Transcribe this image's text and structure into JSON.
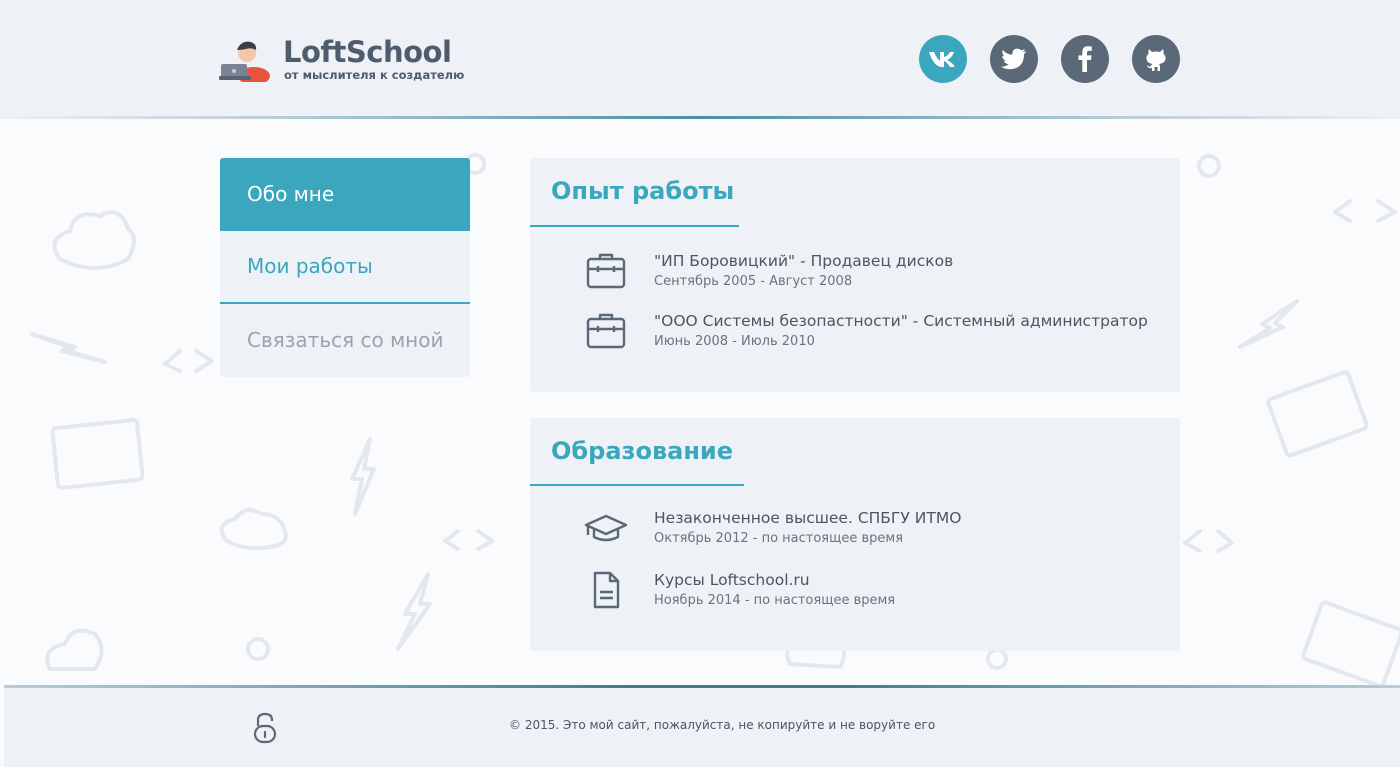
{
  "header": {
    "logo_title": "LoftSchool",
    "logo_subtitle": "от мыслителя к создателю",
    "socials": [
      {
        "name": "vk",
        "icon": "vk-icon",
        "active": true
      },
      {
        "name": "twitter",
        "icon": "twitter-icon",
        "active": false
      },
      {
        "name": "facebook",
        "icon": "facebook-icon",
        "active": false
      },
      {
        "name": "github",
        "icon": "github-icon",
        "active": false
      }
    ]
  },
  "sidebar": {
    "items": [
      {
        "label": "Обо мне",
        "state": "active"
      },
      {
        "label": "Мои работы",
        "state": "normal"
      },
      {
        "label": "Связаться со мной",
        "state": "muted"
      }
    ]
  },
  "experience": {
    "title": "Опыт работы",
    "items": [
      {
        "icon": "briefcase-icon",
        "title": "\"ИП Боровицкий\" - Продавец дисков",
        "date": "Сентябрь 2005 - Август 2008"
      },
      {
        "icon": "briefcase-icon",
        "title": "\"ООО Системы безопастности\" - Системный администратор",
        "date": "Июнь 2008 - Июль 2010"
      }
    ]
  },
  "education": {
    "title": "Образование",
    "items": [
      {
        "icon": "graduation-cap-icon",
        "title": "Незаконченное высшее. СПБГУ ИТМО",
        "date": "Октябрь 2012 - по настоящее время"
      },
      {
        "icon": "document-icon",
        "title": "Курсы Loftschool.ru",
        "date": "Ноябрь 2014 - по настоящее время"
      }
    ]
  },
  "footer": {
    "copyright": "© 2015. Это мой сайт, пожалуйста, не копируйте и не воруйте его",
    "icon": "lock-icon"
  },
  "colors": {
    "accent": "#3ba7bf",
    "panel": "#eef1f6",
    "icon_dark": "#5a6878",
    "text": "#4b5563"
  }
}
